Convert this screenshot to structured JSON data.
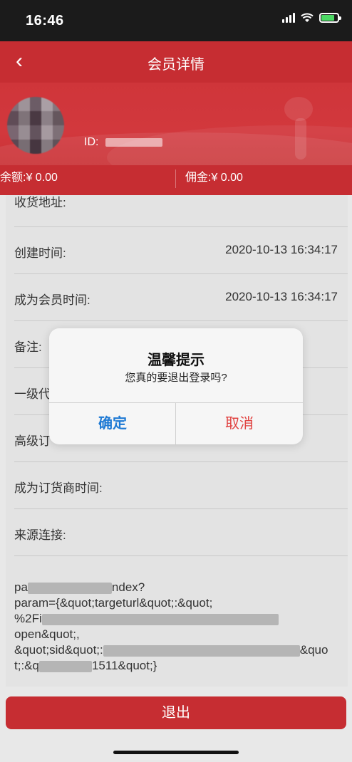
{
  "status_bar": {
    "time": "16:46"
  },
  "nav": {
    "back_label": "‹",
    "title": "会员详情"
  },
  "profile": {
    "id_label": "ID:"
  },
  "balance": {
    "balance_text": "余额:¥ 0.00",
    "commission_text": "佣金:¥ 0.00"
  },
  "fields": [
    {
      "label": "收货地址:",
      "value": ""
    },
    {
      "label": "创建时间:",
      "value": "2020-10-13 16:34:17"
    },
    {
      "label": "成为会员时间:",
      "value": "2020-10-13 16:34:17"
    },
    {
      "label": "备注:",
      "value": ""
    },
    {
      "label": "一级代",
      "value": ""
    },
    {
      "label": "高级订",
      "value": ""
    },
    {
      "label": "成为订货商时间:",
      "value": ""
    },
    {
      "label": "来源连接:",
      "value": ""
    }
  ],
  "source_link": {
    "line1_a": "pa",
    "line1_b": "ndex?",
    "line2": "param={&quot;targeturl&quot;:&quot;",
    "line3_a": "%2Fi",
    "line3_b": "open&quot;,",
    "line4_a": "&quot;sid&quot;:",
    "line4_b": "&quo",
    "line5_a": "t;:&q",
    "line5_b": "1511&quot;}"
  },
  "dialog": {
    "title": "温馨提示",
    "message": "您真的要退出登录吗?",
    "ok_label": "确定",
    "cancel_label": "取消"
  },
  "logout_label": "退出",
  "colors": {
    "brand_red": "#c62d32",
    "ok_blue": "#1f7ad4",
    "cancel_red": "#e0413f"
  }
}
